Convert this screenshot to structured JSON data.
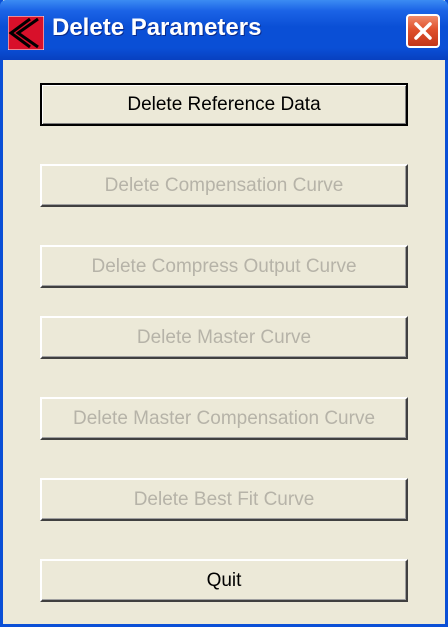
{
  "window": {
    "title": "Delete Parameters",
    "app_icon": "red-k-logo-icon",
    "close_icon": "close-icon"
  },
  "buttons": [
    {
      "label": "Delete Reference Data",
      "enabled": true,
      "default": true
    },
    {
      "label": "Delete Compensation Curve",
      "enabled": false
    },
    {
      "label": "Delete Compress Output Curve",
      "enabled": false
    },
    {
      "label": "Delete Master Curve",
      "enabled": false
    },
    {
      "label": "Delete Master Compensation Curve",
      "enabled": false
    },
    {
      "label": "Delete Best Fit Curve",
      "enabled": false
    },
    {
      "label": "Quit",
      "enabled": true
    }
  ],
  "colors": {
    "titlebar": "#0a4fd6",
    "dialog_bg": "#ece9d8",
    "disabled_text": "#b6b3a8",
    "close_button": "#e0512c"
  }
}
